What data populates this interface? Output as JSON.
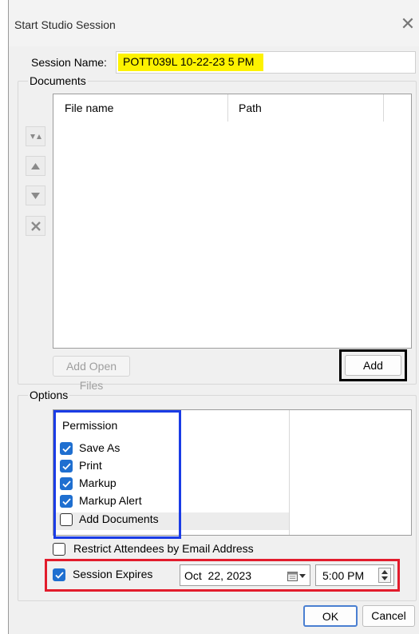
{
  "window": {
    "title": "Start Studio Session",
    "close_glyph": "✕"
  },
  "session": {
    "label": "Session Name:",
    "value": "POTT039L 10-22-23 5 PM"
  },
  "documents": {
    "group_label": "Documents",
    "columns": [
      "File name",
      "Path"
    ],
    "side_buttons": [
      "sort-icon",
      "move-up-icon",
      "move-down-icon",
      "remove-icon"
    ],
    "add_open_files_label": "Add Open Files",
    "add_label": "Add"
  },
  "options": {
    "group_label": "Options",
    "permission_header": "Permission",
    "permissions": [
      {
        "label": "Save As",
        "checked": true
      },
      {
        "label": "Print",
        "checked": true
      },
      {
        "label": "Markup",
        "checked": true
      },
      {
        "label": "Markup Alert",
        "checked": true
      },
      {
        "label": "Add Documents",
        "checked": false
      }
    ],
    "restrict": {
      "label": "Restrict Attendees by Email Address",
      "checked": false
    },
    "expires": {
      "label": "Session Expires",
      "checked": true,
      "date": "Oct  22, 2023",
      "time": "5:00 PM"
    }
  },
  "footer": {
    "ok_label": "OK",
    "cancel_label": "Cancel"
  },
  "colors": {
    "highlight": "#fdf200",
    "checkbox": "#1f6fd0",
    "blue_box": "#1a3ce6",
    "red_box": "#e21c2c"
  }
}
